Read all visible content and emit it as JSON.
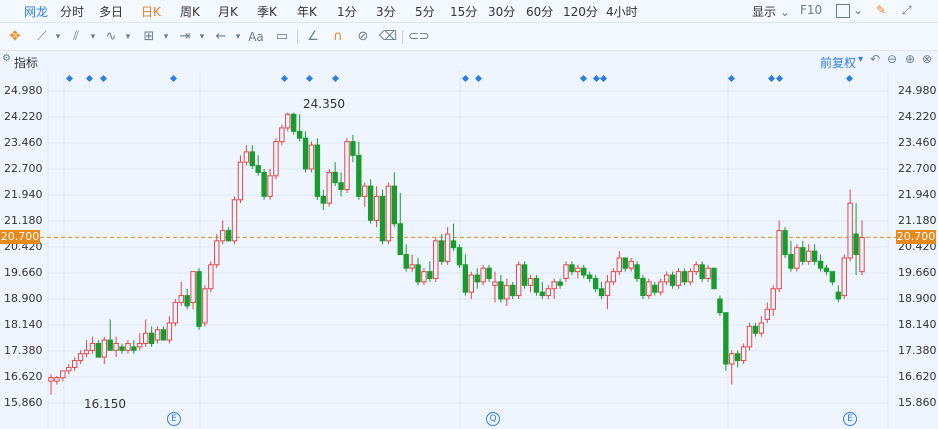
{
  "periods": [
    "网龙",
    "分时",
    "多日",
    "日K",
    "周K",
    "月K",
    "季K",
    "年K",
    "1分",
    "3分",
    "5分",
    "15分",
    "30分",
    "60分",
    "120分",
    "4小时"
  ],
  "active_period": "日K",
  "top_right": {
    "display": "显示",
    "f10": "F10"
  },
  "indicator_label": "指标",
  "adjust_label": "前复权",
  "colors": {
    "up": "#e04848",
    "down": "#1a9b2e",
    "accent": "#e8891c",
    "brand": "#2f7de1",
    "grid": "#dce6f3",
    "bg": "#eef5ff"
  },
  "y_axis_labels": [
    "24.980",
    "24.220",
    "23.460",
    "22.700",
    "21.940",
    "21.180",
    "20.420",
    "19.660",
    "18.900",
    "18.140",
    "17.380",
    "16.620",
    "15.860"
  ],
  "current_price": "20.700",
  "annotations": {
    "high": "24.350",
    "low": "16.150"
  },
  "event_markers": [
    "E",
    "Q",
    "E"
  ],
  "chart_data": {
    "type": "candlestick",
    "ylim": [
      15.75,
      25.3
    ],
    "grid": true,
    "reference_line": 20.7,
    "candles": [
      [
        16.5,
        16.7,
        16.1,
        16.6
      ],
      [
        16.5,
        16.65,
        16.4,
        16.6
      ],
      [
        16.6,
        16.8,
        16.5,
        16.8
      ],
      [
        16.8,
        17,
        16.7,
        16.9
      ],
      [
        16.9,
        17.2,
        16.8,
        17.1
      ],
      [
        17.1,
        17.4,
        17,
        17.3
      ],
      [
        17.3,
        17.7,
        17.2,
        17.4
      ],
      [
        17.4,
        17.8,
        17.3,
        17.6
      ],
      [
        17.6,
        17.7,
        17.2,
        17.2
      ],
      [
        17.2,
        17.8,
        17,
        17.7
      ],
      [
        17.7,
        18.3,
        17.6,
        17.4
      ],
      [
        17.4,
        17.8,
        17.2,
        17.6
      ],
      [
        17.5,
        17.6,
        17.3,
        17.4
      ],
      [
        17.4,
        17.7,
        17.3,
        17.6
      ],
      [
        17.5,
        17.7,
        17.3,
        17.4
      ],
      [
        17.5,
        17.9,
        17.4,
        17.6
      ],
      [
        17.6,
        18.3,
        17.5,
        17.9
      ],
      [
        17.9,
        18.1,
        17.5,
        17.6
      ],
      [
        17.7,
        18.1,
        17.6,
        18
      ],
      [
        18,
        18.1,
        17.7,
        17.7
      ],
      [
        17.7,
        18.4,
        17.6,
        18.2
      ],
      [
        18.2,
        18.9,
        18.1,
        18.8
      ],
      [
        18.8,
        19.4,
        18.7,
        19
      ],
      [
        19,
        19.2,
        18.6,
        18.7
      ],
      [
        18.8,
        19.4,
        18.6,
        19.7
      ],
      [
        19.7,
        19.8,
        18.0,
        18.1
      ],
      [
        18.2,
        19.3,
        18.1,
        19.2
      ],
      [
        19.2,
        20,
        19.1,
        19.9
      ],
      [
        19.9,
        20.8,
        19.8,
        20.6
      ],
      [
        20.6,
        21.2,
        20.5,
        20.9
      ],
      [
        20.9,
        21,
        20.6,
        20.6
      ],
      [
        20.6,
        21.9,
        20.5,
        21.8
      ],
      [
        21.8,
        23.1,
        21.7,
        22.9
      ],
      [
        22.9,
        23.4,
        22.8,
        23.2
      ],
      [
        23.2,
        23.4,
        22.7,
        22.8
      ],
      [
        22.8,
        23.1,
        22.5,
        22.6
      ],
      [
        22.6,
        22.7,
        21.8,
        21.9
      ],
      [
        21.9,
        22.7,
        21.8,
        22.5
      ],
      [
        22.5,
        23.6,
        22.4,
        23.5
      ],
      [
        23.5,
        24.0,
        23.4,
        23.9
      ],
      [
        23.9,
        24.35,
        23.8,
        24.3
      ],
      [
        24.3,
        24.35,
        23.7,
        23.8
      ],
      [
        23.8,
        24.3,
        23.5,
        23.6
      ],
      [
        23.6,
        23.8,
        22.6,
        22.7
      ],
      [
        22.7,
        23.5,
        22.6,
        23.4
      ],
      [
        23.4,
        23.6,
        21.8,
        21.9
      ],
      [
        21.9,
        22.1,
        21.5,
        21.7
      ],
      [
        21.7,
        22.7,
        21.6,
        22.6
      ],
      [
        22.6,
        22.9,
        22.2,
        22.3
      ],
      [
        22.3,
        22.6,
        21.9,
        22.1
      ],
      [
        22.1,
        23.6,
        22.0,
        23.5
      ],
      [
        23.5,
        23.7,
        22.9,
        23.1
      ],
      [
        23.1,
        23.5,
        21.8,
        21.9
      ],
      [
        21.9,
        22.3,
        21.6,
        22.2
      ],
      [
        22.2,
        22.4,
        21.1,
        21.2
      ],
      [
        21.2,
        22.2,
        21.0,
        21.9
      ],
      [
        21.9,
        22.1,
        20.5,
        20.6
      ],
      [
        20.6,
        22.3,
        20.5,
        22.2
      ],
      [
        22.2,
        22.6,
        21.0,
        21.1
      ],
      [
        21.1,
        22,
        20.3,
        20.2
      ],
      [
        20.2,
        20.5,
        19.7,
        19.8
      ],
      [
        19.8,
        20.2,
        19.7,
        19.9
      ],
      [
        19.9,
        20.1,
        19.3,
        19.4
      ],
      [
        19.4,
        19.8,
        19.3,
        19.7
      ],
      [
        19.7,
        20,
        19.4,
        19.5
      ],
      [
        19.5,
        20.7,
        19.4,
        20.6
      ],
      [
        20.6,
        20.8,
        19.9,
        20
      ],
      [
        20.0,
        21.0,
        19.9,
        20.8
      ],
      [
        20.6,
        21.1,
        20.3,
        20.4
      ],
      [
        20.4,
        20.5,
        19.8,
        19.9
      ],
      [
        19.9,
        20.2,
        19.0,
        19.1
      ],
      [
        19.1,
        19.7,
        18.9,
        19.6
      ],
      [
        19.6,
        19.8,
        19.2,
        19.4
      ],
      [
        19.4,
        19.9,
        19.3,
        19.8
      ],
      [
        19.8,
        19.9,
        19.4,
        19.5
      ],
      [
        19.3,
        19.7,
        18.8,
        19.4
      ],
      [
        19.4,
        19.6,
        18.8,
        18.9
      ],
      [
        18.9,
        19.5,
        18.7,
        19.3
      ],
      [
        19.3,
        19.4,
        18.9,
        19
      ],
      [
        19.0,
        20.0,
        18.9,
        19.9
      ],
      [
        19.9,
        20.0,
        19.2,
        19.3
      ],
      [
        19.3,
        19.6,
        19.1,
        19.5
      ],
      [
        19.5,
        19.6,
        19.0,
        19.1
      ],
      [
        19.1,
        19.4,
        18.9,
        19.0
      ],
      [
        19.0,
        19.3,
        18.9,
        19.2
      ],
      [
        19.2,
        19.5,
        18.9,
        19.4
      ],
      [
        19.4,
        19.5,
        19.2,
        19.3
      ],
      [
        19.5,
        20.0,
        19.4,
        19.9
      ],
      [
        19.9,
        20.0,
        19.6,
        19.7
      ],
      [
        19.7,
        19.9,
        19.5,
        19.8
      ],
      [
        19.8,
        19.9,
        19.5,
        19.6
      ],
      [
        19.6,
        19.7,
        19.4,
        19.5
      ],
      [
        19.5,
        19.6,
        19.1,
        19.2
      ],
      [
        19.2,
        19.4,
        18.9,
        19.0
      ],
      [
        19.0,
        19.6,
        18.6,
        19.4
      ],
      [
        19.4,
        19.8,
        19.3,
        19.7
      ],
      [
        19.7,
        20.3,
        19.6,
        20.1
      ],
      [
        20.1,
        20.1,
        19.7,
        19.8
      ],
      [
        19.8,
        20.1,
        19.7,
        20.0
      ],
      [
        19.9,
        20.0,
        19.4,
        19.5
      ],
      [
        19.5,
        19.6,
        18.9,
        19.0
      ],
      [
        19.0,
        19.5,
        18.9,
        19.4
      ],
      [
        19.3,
        19.4,
        19.0,
        19.1
      ],
      [
        19.1,
        19.5,
        19.0,
        19.4
      ],
      [
        19.4,
        19.7,
        19.3,
        19.6
      ],
      [
        19.6,
        19.7,
        19.2,
        19.3
      ],
      [
        19.3,
        19.8,
        19.2,
        19.7
      ],
      [
        19.7,
        19.8,
        19.3,
        19.4
      ],
      [
        19.4,
        19.8,
        19.3,
        19.7
      ],
      [
        19.7,
        20.0,
        19.6,
        19.9
      ],
      [
        19.9,
        20.0,
        19.4,
        19.5
      ],
      [
        19.5,
        19.9,
        19.4,
        19.8
      ],
      [
        19.8,
        19.8,
        19.2,
        19.2
      ],
      [
        18.9,
        19.0,
        18.4,
        18.5
      ],
      [
        18.5,
        18.5,
        16.8,
        17.0
      ],
      [
        17.0,
        17.4,
        16.4,
        17.3
      ],
      [
        17.3,
        17.4,
        16.9,
        17.1
      ],
      [
        17.1,
        17.6,
        17.0,
        17.5
      ],
      [
        17.5,
        18.2,
        17.4,
        18.1
      ],
      [
        18.1,
        18.2,
        17.8,
        17.9
      ],
      [
        17.9,
        18.4,
        17.8,
        18.2
      ],
      [
        18.3,
        18.8,
        18.2,
        18.6
      ],
      [
        18.6,
        19.3,
        18.4,
        19.2
      ],
      [
        19.2,
        21.2,
        19.1,
        20.9
      ],
      [
        20.9,
        21.0,
        20.1,
        20.2
      ],
      [
        20.2,
        20.6,
        19.7,
        19.8
      ],
      [
        19.8,
        20.5,
        19.7,
        20.4
      ],
      [
        20.4,
        20.6,
        19.9,
        20.0
      ],
      [
        20.0,
        20.5,
        19.9,
        20.3
      ],
      [
        20.3,
        20.5,
        19.9,
        20.0
      ],
      [
        20.0,
        20.2,
        19.7,
        19.8
      ],
      [
        19.8,
        19.9,
        19.6,
        19.7
      ],
      [
        19.7,
        19.7,
        19.3,
        19.4
      ],
      [
        19.1,
        19.3,
        18.8,
        18.9
      ],
      [
        19.0,
        20.2,
        18.9,
        20.1
      ],
      [
        20.1,
        22.1,
        20.0,
        21.7
      ],
      [
        20.8,
        21.7,
        19.6,
        20.2
      ],
      [
        19.7,
        21.2,
        19.6,
        20.7
      ]
    ]
  }
}
